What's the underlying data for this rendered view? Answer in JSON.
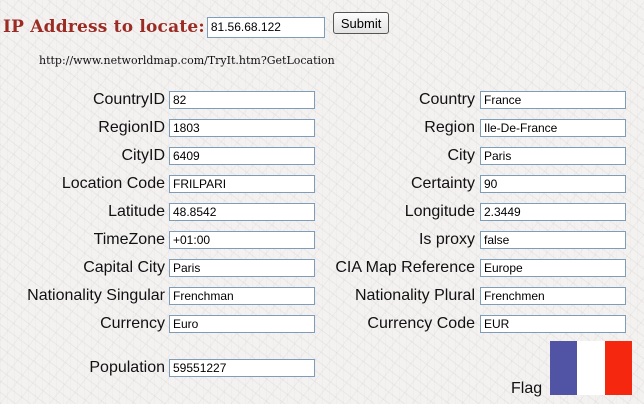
{
  "header": {
    "title": "IP Address to locate:",
    "ip_value": "81.56.68.122",
    "submit_label": "Submit"
  },
  "url_text": "http://www.networldmap.com/TryIt.htm?GetLocation",
  "fields_left": [
    {
      "label": "CountryID",
      "value": "82"
    },
    {
      "label": "RegionID",
      "value": "1803"
    },
    {
      "label": "CityID",
      "value": "6409"
    },
    {
      "label": "Location Code",
      "value": "FRILPARI"
    },
    {
      "label": "Latitude",
      "value": "48.8542"
    },
    {
      "label": "TimeZone",
      "value": "+01:00"
    },
    {
      "label": "Capital City",
      "value": "Paris"
    },
    {
      "label": "Nationality Singular",
      "value": "Frenchman"
    },
    {
      "label": "Currency",
      "value": "Euro"
    },
    {
      "label": "Population",
      "value": "59551227"
    }
  ],
  "fields_right": [
    {
      "label": "Country",
      "value": "France"
    },
    {
      "label": "Region",
      "value": "Ile-De-France"
    },
    {
      "label": "City",
      "value": "Paris"
    },
    {
      "label": "Certainty",
      "value": "90"
    },
    {
      "label": "Longitude",
      "value": "2.3449"
    },
    {
      "label": "Is proxy",
      "value": "false"
    },
    {
      "label": "CIA Map Reference",
      "value": "Europe"
    },
    {
      "label": "Nationality Plural",
      "value": "Frenchmen"
    },
    {
      "label": "Currency Code",
      "value": "EUR"
    }
  ],
  "flag": {
    "label": "Flag",
    "colors": [
      "#5154a4",
      "#ffffff",
      "#f5270f"
    ]
  }
}
